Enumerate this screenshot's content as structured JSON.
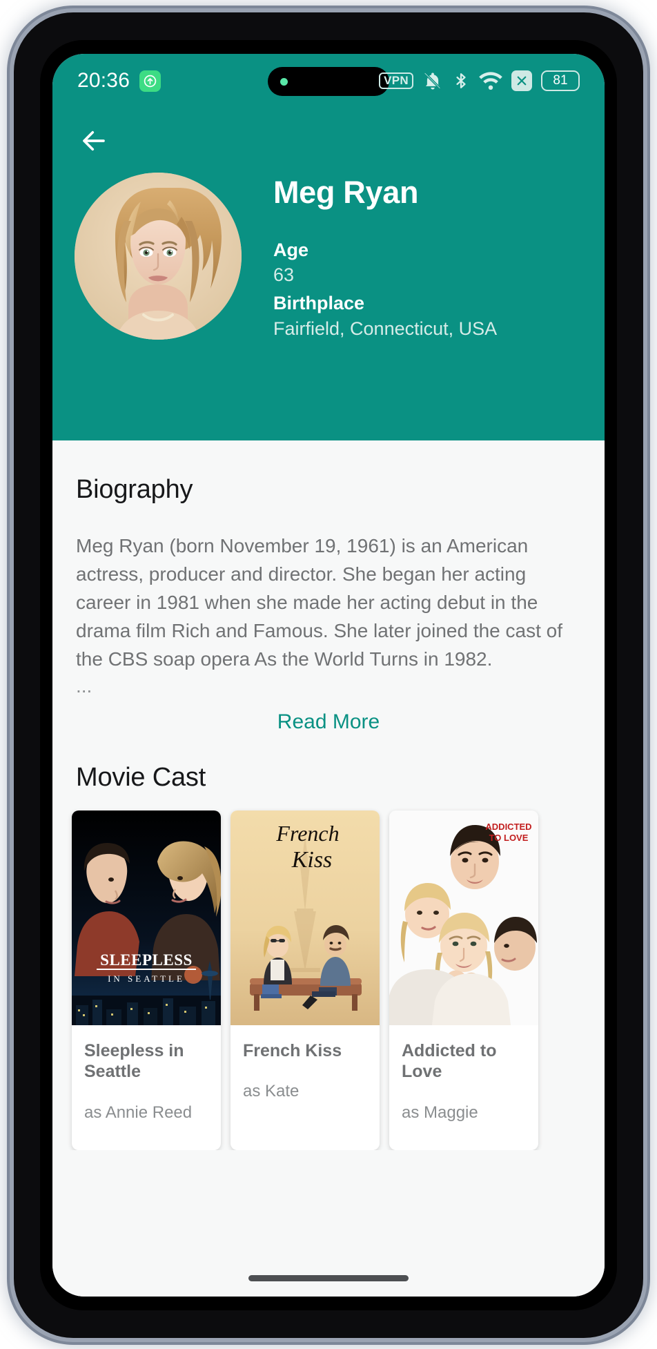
{
  "status_bar": {
    "clock": "20:36",
    "upload_icon": "upload-circle-icon",
    "vpn_label": "VPN",
    "notification_icon": "bell-muted-icon",
    "bluetooth_icon": "bluetooth-icon",
    "wifi_icon": "wifi-icon",
    "sim_icon": "no-sim-x-icon",
    "battery_level": "81"
  },
  "header": {
    "back_icon": "back-arrow-icon",
    "avatar_alt": "Meg Ryan portrait",
    "name": "Meg Ryan",
    "fields": [
      {
        "label": "Age",
        "value": "63"
      },
      {
        "label": "Birthplace",
        "value": "Fairfield, Connecticut, USA"
      }
    ]
  },
  "biography": {
    "title": "Biography",
    "text": "Meg Ryan (born November 19, 1961) is an American actress, producer and director. She began her acting career in 1981 when she made her acting debut in the drama film Rich and Famous. She later joined the cast of the CBS soap opera As the World Turns in 1982.",
    "ellipsis": "...",
    "read_more_label": "Read More"
  },
  "movie_cast": {
    "title": "Movie Cast",
    "items": [
      {
        "title": "Sleepless in Seattle",
        "role": "as Annie Reed",
        "poster": "sleepless-in-seattle-poster"
      },
      {
        "title": "French Kiss",
        "role": "as Kate",
        "poster": "french-kiss-poster"
      },
      {
        "title": "Addicted to Love",
        "role": "as Maggie",
        "poster": "addicted-to-love-poster"
      }
    ]
  },
  "colors": {
    "accent": "#0a9183",
    "background": "#f7f8f8",
    "body_text": "#707274"
  }
}
